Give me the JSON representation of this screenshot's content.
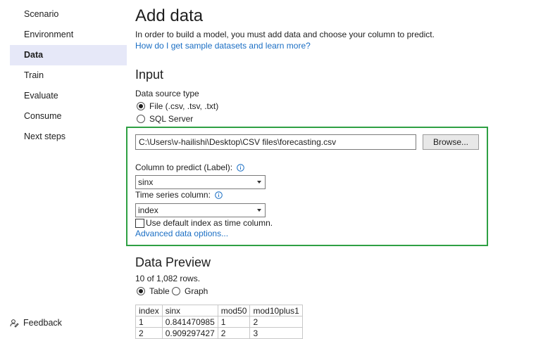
{
  "sidebar": {
    "items": [
      {
        "label": "Scenario"
      },
      {
        "label": "Environment"
      },
      {
        "label": "Data"
      },
      {
        "label": "Train"
      },
      {
        "label": "Evaluate"
      },
      {
        "label": "Consume"
      },
      {
        "label": "Next steps"
      }
    ],
    "active_item": "Data",
    "feedback_label": "Feedback"
  },
  "header": {
    "title": "Add data",
    "intro": "In order to build a model, you must add data and choose your column to predict.",
    "sample_link": "How do I get sample datasets and learn more?"
  },
  "input": {
    "heading": "Input",
    "data_source_label": "Data source type",
    "file_option": "File (.csv, .tsv, .txt)",
    "sql_option": "SQL Server",
    "selected_source": "File (.csv, .tsv, .txt)",
    "file_path": "C:\\Users\\v-hailishi\\Desktop\\CSV files\\forecasting.csv",
    "browse_label": "Browse...",
    "label_column_label": "Column to predict (Label):",
    "label_column_value": "sinx",
    "time_series_label": "Time series column:",
    "time_series_value": "index",
    "default_index_checkbox": "Use default index as time column.",
    "default_index_checked": false,
    "advanced_link": "Advanced data options..."
  },
  "preview": {
    "heading": "Data Preview",
    "rows_info": "10 of 1,082 rows.",
    "view_table": "Table",
    "view_graph": "Graph",
    "selected_view": "Table",
    "columns": [
      "index",
      "sinx",
      "mod50",
      "mod10plus1"
    ],
    "rows": [
      [
        "1",
        "0.841470985",
        "1",
        "2"
      ],
      [
        "2",
        "0.909297427",
        "2",
        "3"
      ]
    ]
  },
  "colors": {
    "accent_link": "#1a6ec4",
    "highlight_border": "#2ea043",
    "active_nav_bg": "#e6e8f8"
  }
}
